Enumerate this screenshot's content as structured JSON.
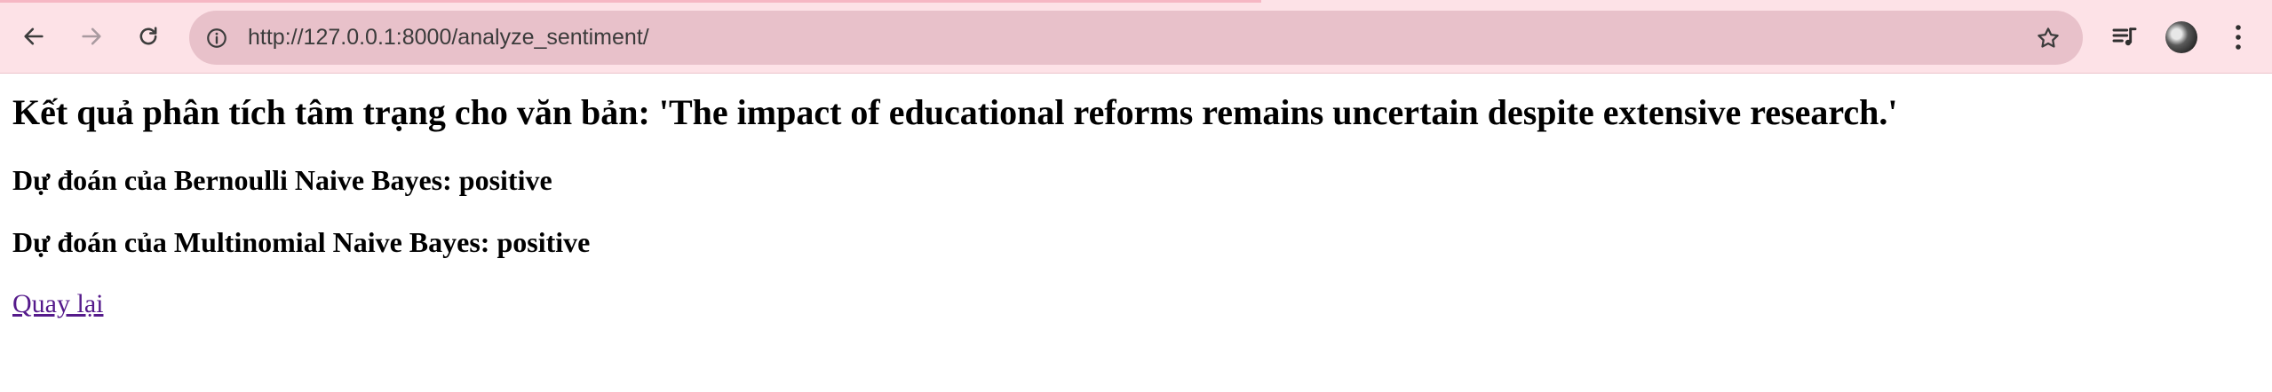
{
  "browser": {
    "url": "http://127.0.0.1:8000/analyze_sentiment/",
    "chrome_color": "#fde2e7",
    "omnibox_color": "#e8c1ca"
  },
  "icons": {
    "back": "arrow-left-icon",
    "forward": "arrow-right-icon",
    "reload": "reload-icon",
    "site_info": "info-icon",
    "bookmark": "star-icon",
    "media": "media-queue-icon",
    "menu": "kebab-menu-icon"
  },
  "page": {
    "title": "Kết quả phân tích tâm trạng cho văn bản: 'The impact of educational reforms remains uncertain despite extensive research.'",
    "bernoulli": "Dự đoán của Bernoulli Naive Bayes: positive",
    "multinomial": "Dự đoán của Multinomial Naive Bayes: positive",
    "back_link": "Quay lại",
    "link_color": "#551a8b"
  }
}
